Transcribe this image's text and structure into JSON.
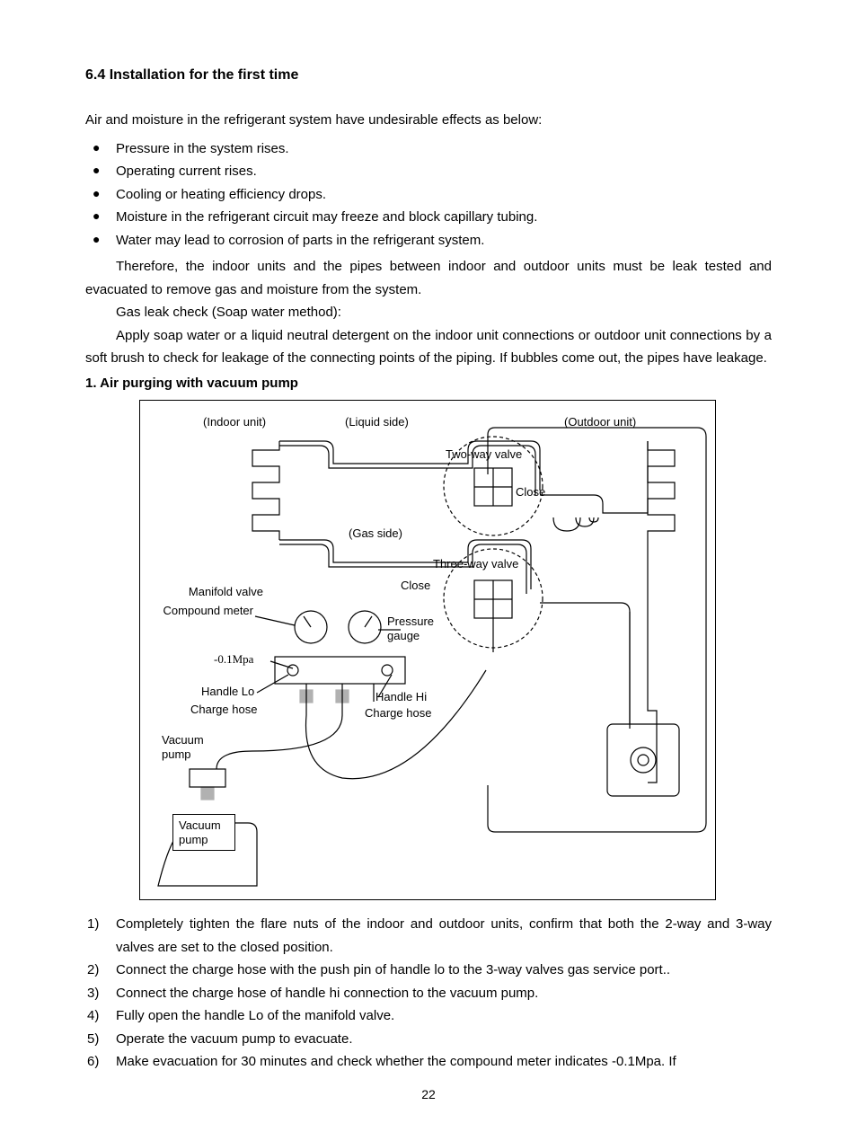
{
  "heading": "6.4 Installation for the first time",
  "intro": "Air and moisture in the refrigerant system have undesirable effects as below:",
  "bullets": [
    "Pressure in the system rises.",
    "Operating current rises.",
    "Cooling or heating efficiency drops.",
    "Moisture in the refrigerant circuit may freeze and block capillary tubing.",
    "Water may lead to corrosion of parts in the refrigerant system."
  ],
  "para1": "Therefore, the indoor units and the pipes between indoor and outdoor units must be leak tested and evacuated to remove gas and moisture from the system.",
  "para2": "Gas leak check (Soap water method):",
  "para3": "Apply soap water or a liquid neutral detergent on the indoor unit connections or outdoor unit connections by a soft brush to check for leakage of the connecting points of the piping. If bubbles come out, the pipes have leakage.",
  "subhead": "1. Air purging with vacuum pump",
  "steps": [
    "Completely tighten the flare nuts of the indoor and outdoor units, confirm that both the 2-way and 3-way valves are set to the closed position.",
    "Connect the charge hose with the push pin of handle lo to the 3-way valves gas service port..",
    "Connect the charge hose of handle hi connection to the vacuum pump.",
    "Fully open the handle Lo of the manifold valve.",
    "Operate the vacuum pump to evacuate.",
    "Make evacuation for 30 minutes and check whether the compound meter indicates -0.1Mpa. If"
  ],
  "diagram": {
    "indoor": "(Indoor unit)",
    "liquid": "(Liquid side)",
    "outdoor": "(Outdoor unit)",
    "twoway": "Two-way valve",
    "close1": "Close",
    "gas": "(Gas side)",
    "threeway": "Three-way valve",
    "close2": "Close",
    "manifold": "Manifold valve",
    "compound": "Compound meter",
    "pressure": "Pressure gauge",
    "mpa": "-0.1Mpa",
    "hlo": "Handle Lo",
    "hhi": "Handle Hi",
    "chose1": "Charge hose",
    "chose2": "Charge hose",
    "vpump1": "Vacuum pump",
    "vpump2": "Vacuum pump"
  },
  "pagenum": "22"
}
